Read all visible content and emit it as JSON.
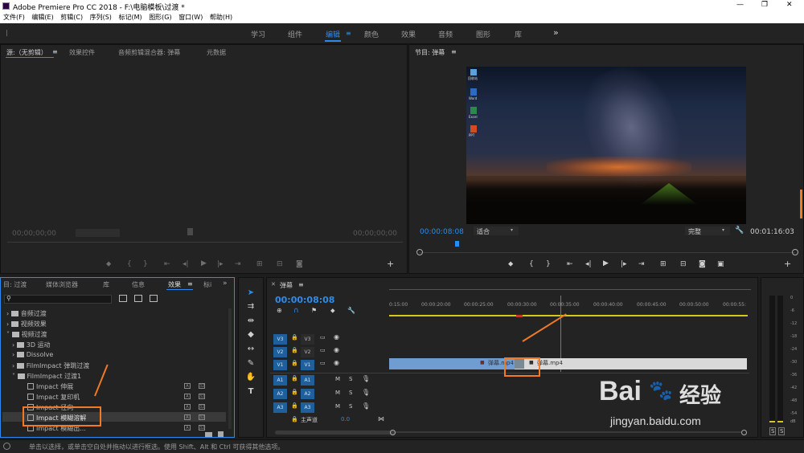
{
  "window": {
    "title": "Adobe Premiere Pro CC 2018 - F:\\电脑模板\\过渡 *",
    "controls": [
      "—",
      "❐",
      "✕"
    ]
  },
  "menu": [
    "文件(F)",
    "编辑(E)",
    "剪辑(C)",
    "序列(S)",
    "标记(M)",
    "图形(G)",
    "窗口(W)",
    "帮助(H)"
  ],
  "workspaces": [
    "学习",
    "组件",
    "编辑",
    "颜色",
    "效果",
    "音频",
    "图形",
    "库"
  ],
  "workspace_more": "»",
  "source_panel": {
    "tabs": [
      "源:（无剪辑）",
      "效果控件",
      "音频剪辑混合器: 弹幕",
      "元数据"
    ],
    "timecode_left": "00;00;00;00",
    "timecode_right": "00;00;00;00",
    "add": "+"
  },
  "program_panel": {
    "title": "节目: 弹幕",
    "timecode": "00:00:08:08",
    "fit": "适合",
    "quality": "完整",
    "duration": "00:01:16:03",
    "add": "+"
  },
  "desktop_icons": [
    "回收站",
    "Word",
    "Excel",
    "PPT"
  ],
  "effects_panel": {
    "tabs": [
      "目: 过渡",
      "媒体浏览器",
      "库",
      "信息",
      "效果",
      "标i"
    ],
    "tree": [
      "音频过渡",
      "视频效果",
      "视频过渡",
      "3D 运动",
      "Dissolve",
      "FilmImpact 弹跳过渡",
      "FilmImpact 过渡1",
      "Impact 伸展",
      "Impact 复印机",
      "Impact 径向",
      "Impact 模糊溶解",
      "Impact 模糊出..."
    ]
  },
  "timeline": {
    "title": "弹幕",
    "timecode": "00:00:08:08",
    "ruler": [
      "0:15:00",
      "00:00:20:00",
      "00:00:25:00",
      "00:00:30:00",
      "00:00:35:00",
      "00:00:40:00",
      "00:00:45:00",
      "00:00:50:00",
      "00:00:55:"
    ],
    "video_tracks": [
      "V3",
      "V2",
      "V1"
    ],
    "audio_tracks": [
      "A1",
      "A2",
      "A3"
    ],
    "track_m": "M",
    "track_s": "S",
    "master": "主声道",
    "master_value": "0.0",
    "clip_left": "弹幕.mp4",
    "clip_right": "弹幕.mp4"
  },
  "meter": {
    "labels": [
      "0",
      "-6",
      "-12",
      "-18",
      "-24",
      "-30",
      "-36",
      "-42",
      "-48",
      "-54",
      "dB"
    ],
    "solo": [
      "S",
      "S"
    ]
  },
  "status_text": "单击以选择，或单击空白处并拖动以进行框选。使用 Shift、Alt 和 Ctrl 可获得其他选项。",
  "watermark": {
    "brand": "Bai",
    "paw": "🐾",
    "brand2": "经验",
    "url": "jingyan.baidu.com"
  },
  "colors": {
    "accent": "#2d8ceb",
    "highlight": "#f07a26"
  }
}
